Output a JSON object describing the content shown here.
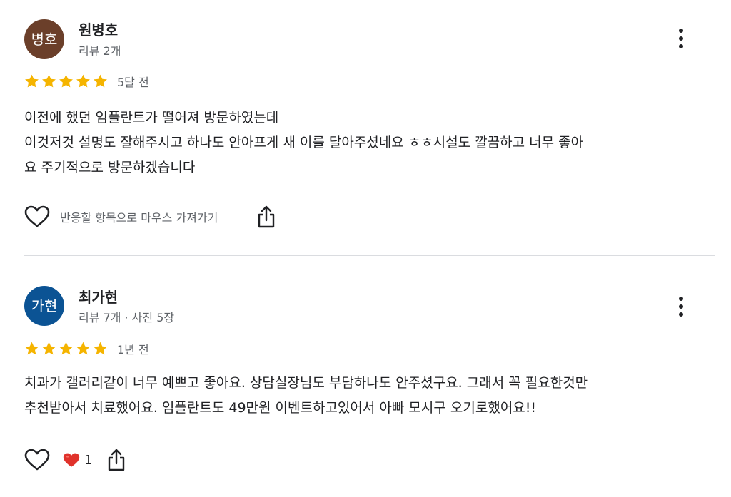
{
  "colors": {
    "star": "#f5b400",
    "text_primary": "#202124",
    "text_secondary": "#5f6368",
    "divider": "#dadce0",
    "reaction_heart": "#e0322b"
  },
  "reviews": [
    {
      "avatar_text": "병호",
      "avatar_color": "#6b3f2a",
      "name": "원병호",
      "meta": "리뷰 2개",
      "rating": 5,
      "date": "5달 전",
      "text": "이전에 했던 임플란트가 떨어져 방문하였는데\n이것저것 설명도 잘해주시고 하나도 안아프게 새 이를 달아주셨네요 ㅎㅎ시설도 깔끔하고 너무 좋아\n요 주기적으로 방문하겠습니다",
      "helpful_prompt": "반응할 항목으로 마우스 가져가기",
      "like_icon": "heart-outline-icon",
      "share_icon": "share-icon",
      "more_icon": "more-vertical-icon"
    },
    {
      "avatar_text": "가현",
      "avatar_color": "#0b5394",
      "name": "최가현",
      "meta": "리뷰 7개 · 사진 5장",
      "rating": 5,
      "date": "1년 전",
      "text": "치과가 갤러리같이 너무 예쁘고 좋아요. 상담실장님도 부담하나도 안주셨구요. 그래서 꼭 필요한것만\n추천받아서 치료했어요. 임플란트도 49만원 이벤트하고있어서 아빠 모시구 오기로했어요!!",
      "reaction_icon": "red-heart-icon",
      "reaction_count": "1",
      "like_icon": "heart-outline-icon",
      "share_icon": "share-icon",
      "more_icon": "more-vertical-icon"
    }
  ]
}
